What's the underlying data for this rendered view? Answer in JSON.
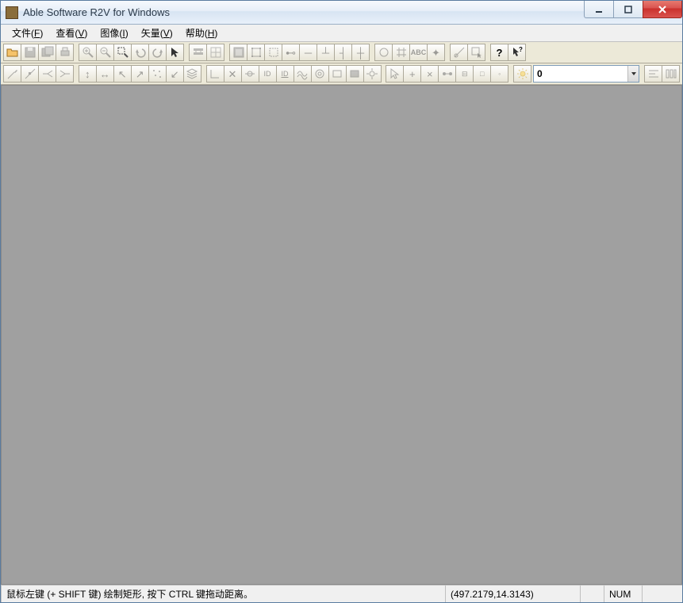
{
  "window": {
    "title": "Able Software R2V for Windows"
  },
  "menubar": {
    "items": [
      {
        "label": "文件(F)",
        "u": "F"
      },
      {
        "label": "查看(V)",
        "u": "V"
      },
      {
        "label": "图像(I)",
        "u": "I"
      },
      {
        "label": "矢量(V)",
        "u": "V"
      },
      {
        "label": "帮助(H)",
        "u": "H"
      }
    ]
  },
  "toolbar1": {
    "groups": [
      [
        "open-file",
        "save",
        "save-project",
        "print"
      ],
      [
        "zoom-in",
        "zoom-out",
        "zoom-region",
        "undo",
        "redo",
        "pointer"
      ],
      [
        "auto-vectorize",
        "grid-settings"
      ],
      [
        "layer-panel",
        "bounds",
        "crop",
        "node-start",
        "node-mid",
        "node-join",
        "node-end",
        "node-split"
      ],
      [
        "circle-tool",
        "grid-tool",
        "text-tool",
        "snap-tool"
      ],
      [
        "measure",
        "select-rect"
      ],
      [
        "help",
        "context-help"
      ]
    ]
  },
  "toolbar2": {
    "groups": [
      [
        "line-draw",
        "line-edit",
        "polyline-left",
        "polyline-right"
      ],
      [
        "move-vertical",
        "move-horizontal",
        "arrow-upleft",
        "arrow-upright",
        "scatter",
        "arrow-downleft",
        "layers"
      ],
      [
        "corner",
        "cross",
        "through",
        "id-tag",
        "id-tag2",
        "contour",
        "contour2",
        "rect-tool",
        "rect-fill",
        "settings"
      ],
      [
        "cursor",
        "add-point",
        "delete-point",
        "join-points",
        "break-point",
        "snap-point",
        "end-point"
      ],
      [
        "highlight"
      ]
    ],
    "combo_value": "0",
    "tail": [
      "align",
      "distribute"
    ]
  },
  "statusbar": {
    "hint": "鼠标左键 (+ SHIFT 键) 绘制矩形, 按下 CTRL 键拖动距离。",
    "coords": "(497.2179,14.3143)",
    "num": "NUM"
  }
}
